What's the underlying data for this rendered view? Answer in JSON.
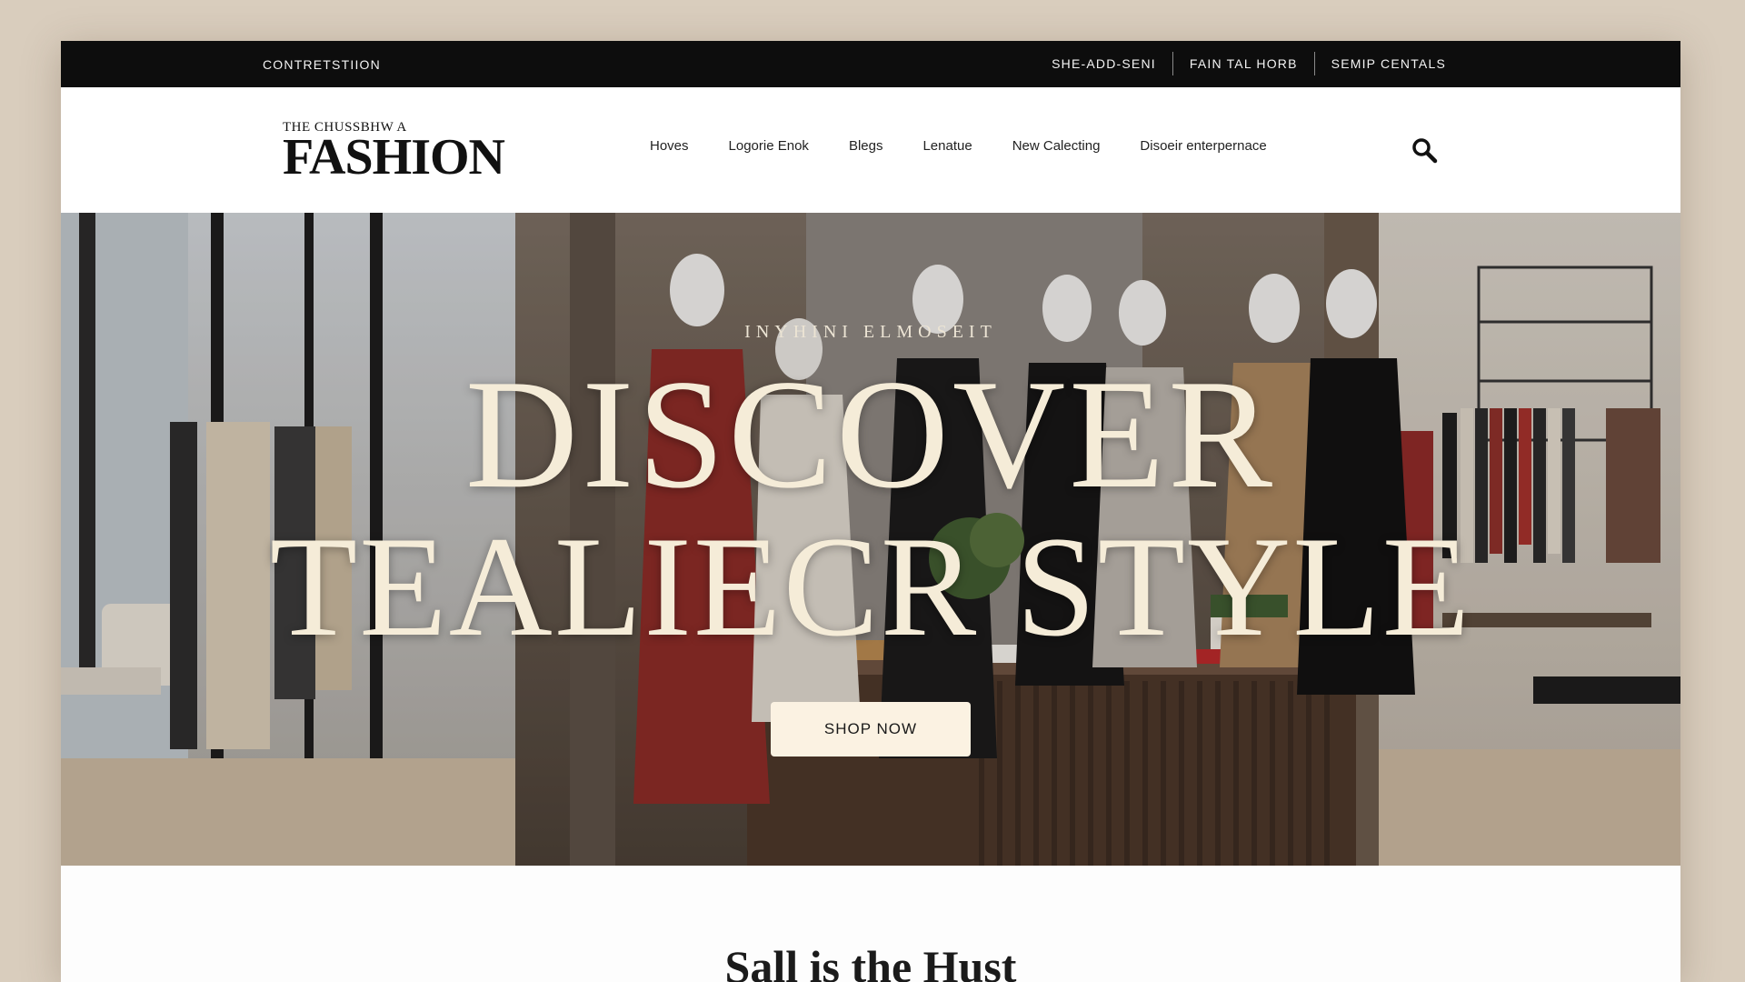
{
  "utility_bar": {
    "left_link": "CONTRETSTIION",
    "right_links": [
      "SHE-ADD-SENI",
      "FAIN TAL HORB",
      "SEMIP CENTALS"
    ]
  },
  "header": {
    "logo_small": "THE CHUSSBHW A",
    "logo_big": "FASHION",
    "nav": [
      "Hoves",
      "Logorie Enok",
      "Blegs",
      "Lenatue",
      "New Calecting",
      "Disoeir enterpernace"
    ],
    "search_icon": "search-icon"
  },
  "hero": {
    "eyebrow": "INYHINI ELMOSEIT",
    "title_line1": "DISCOVER",
    "title_line2": "TEALIECR STYLE",
    "cta_label": "SHOP NOW"
  },
  "section": {
    "title": "Sall is the Hust"
  },
  "colors": {
    "background": "#d9cdbd",
    "utility_bar": "#0d0d0d",
    "hero_text": "#f5ecd8",
    "cta_bg": "#fbf2e2"
  }
}
